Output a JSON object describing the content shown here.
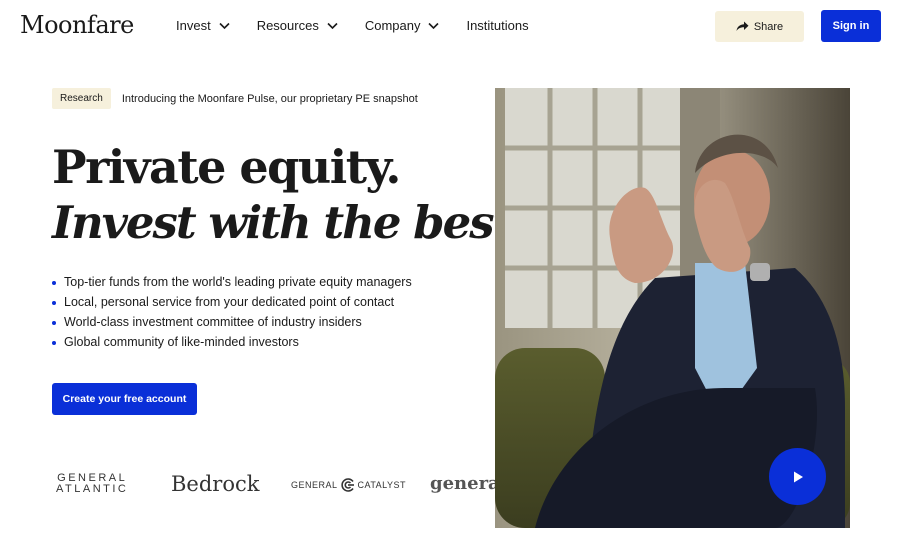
{
  "header": {
    "logo": "Moonfare",
    "nav": [
      {
        "label": "Invest",
        "has_dropdown": true
      },
      {
        "label": "Resources",
        "has_dropdown": true
      },
      {
        "label": "Company",
        "has_dropdown": true
      },
      {
        "label": "Institutions",
        "has_dropdown": false
      }
    ],
    "share_label": "Share",
    "signin_label": "Sign in"
  },
  "announcement": {
    "badge": "Research",
    "text": "Introducing the Moonfare Pulse, our proprietary PE snapshot"
  },
  "hero": {
    "headline_line1": "Private equity.",
    "headline_line2": "Invest with the best.",
    "bullets": [
      "Top-tier funds from the world's leading private equity managers",
      "Local, personal service from your dedicated point of contact",
      "World-class investment committee of industry insiders",
      "Global community of like-minded investors"
    ],
    "cta_label": "Create your free account"
  },
  "partner_logos": {
    "general_atlantic_line1": "GENERAL",
    "general_atlantic_line2": "ATLANTIC",
    "bedrock": "Bedrock",
    "general_catalyst_left": "GENERAL",
    "general_catalyst_right": "CATALYST",
    "generation": "generati"
  },
  "video": {
    "play_icon": "play-icon"
  },
  "colors": {
    "accent": "#0a2fd8",
    "badge_bg": "#f6f0dc",
    "text": "#1a1a1a"
  }
}
